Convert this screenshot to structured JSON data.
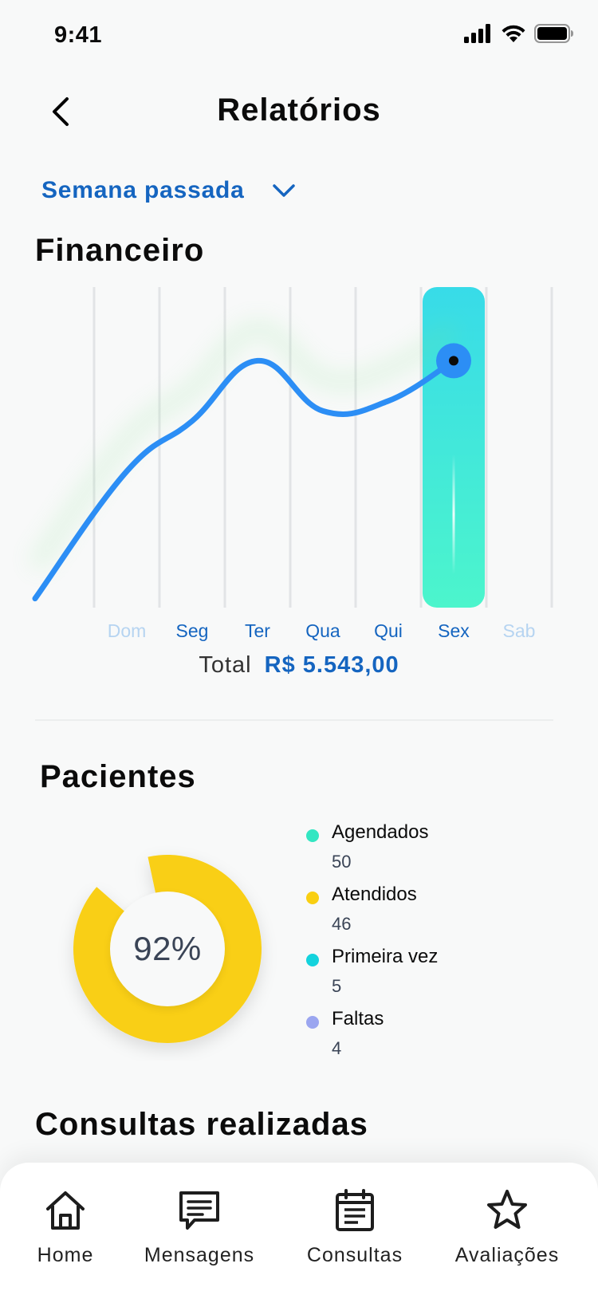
{
  "status_bar": {
    "time": "9:41"
  },
  "header": {
    "title": "Relatórios"
  },
  "period": {
    "selected": "Semana passada"
  },
  "financeiro": {
    "title": "Financeiro",
    "total_label": "Total",
    "total_value": "R$ 5.543,00"
  },
  "pacientes": {
    "title": "Pacientes",
    "percent": "92%",
    "legend": [
      {
        "name": "Agendados",
        "count": "50",
        "color": "#33e6c2"
      },
      {
        "name": "Atendidos",
        "count": "46",
        "color": "#f9cf12"
      },
      {
        "name": "Primeira vez",
        "count": "5",
        "color": "#14d3dd"
      },
      {
        "name": "Faltas",
        "count": "4",
        "color": "#9ba6f0"
      }
    ]
  },
  "consultas": {
    "title": "Consultas realizadas"
  },
  "nav": {
    "home": "Home",
    "mensagens": "Mensagens",
    "consultas": "Consultas",
    "avaliacoes": "Avaliações"
  },
  "colors": {
    "accent_blue": "#1565c0",
    "line_blue": "#2c8ef5",
    "highlight_top": "#38dbe8",
    "highlight_bottom": "#4cf5cc",
    "donut_yellow": "#f9cf12"
  },
  "chart_data": {
    "type": "line",
    "categories": [
      "Dom",
      "Seg",
      "Ter",
      "Qua",
      "Qui",
      "Sex",
      "Sab"
    ],
    "selected": "Sex",
    "muted": [
      "Dom",
      "Sab"
    ],
    "series": [
      {
        "values": [
          0.45,
          0.6,
          0.78,
          0.63,
          0.66,
          0.78
        ]
      }
    ],
    "grid": "vertical",
    "total": "R$ 5.543,00"
  }
}
